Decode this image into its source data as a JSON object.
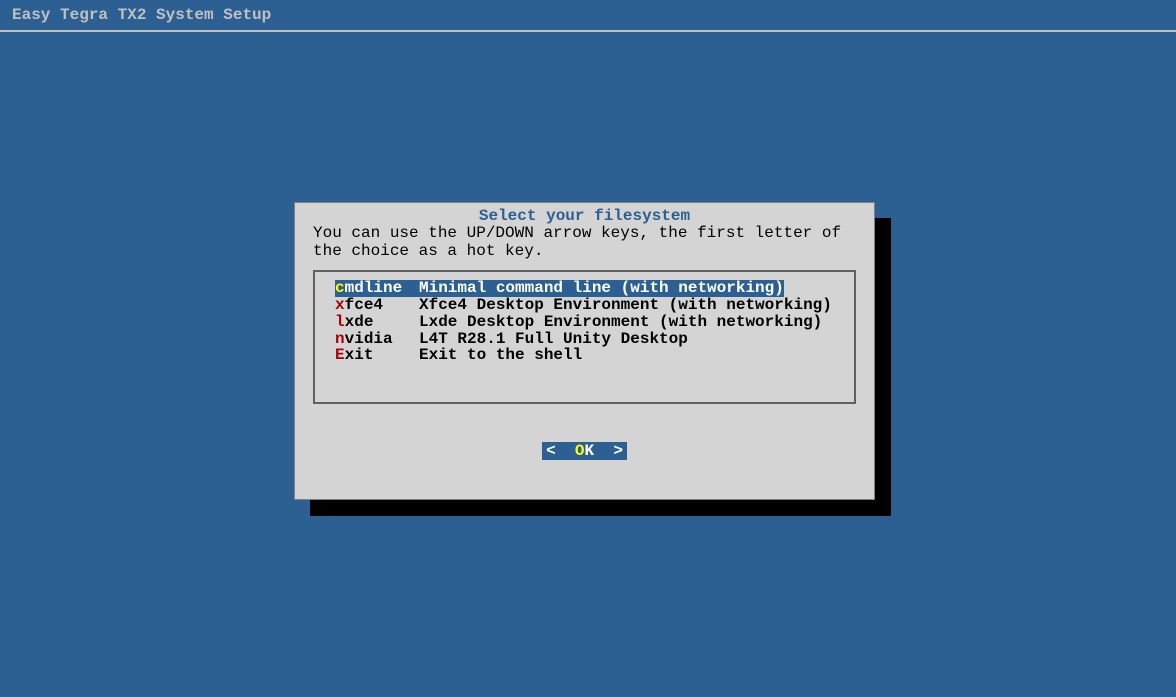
{
  "page_title": "Easy Tegra TX2 System Setup",
  "dialog": {
    "title": "Select your filesystem",
    "instruction": "You can use the UP/DOWN arrow keys, the first letter of the choice as a hot key.",
    "menu_items": [
      {
        "hotkey": "c",
        "key_rest": "mdline",
        "description": "Minimal command line (with networking)",
        "selected": true
      },
      {
        "hotkey": "x",
        "key_rest": "fce4",
        "description": "Xfce4 Desktop Environment (with networking)",
        "selected": false
      },
      {
        "hotkey": "l",
        "key_rest": "xde",
        "description": "Lxde Desktop Environment (with networking)",
        "selected": false
      },
      {
        "hotkey": "n",
        "key_rest": "vidia",
        "description": "L4T R28.1 Full Unity Desktop",
        "selected": false
      },
      {
        "hotkey": "E",
        "key_rest": "xit",
        "description": "Exit to the shell",
        "selected": false
      }
    ],
    "button": {
      "left_bracket": "<",
      "right_bracket": ">",
      "label_o": "O",
      "label_k": "K"
    }
  }
}
